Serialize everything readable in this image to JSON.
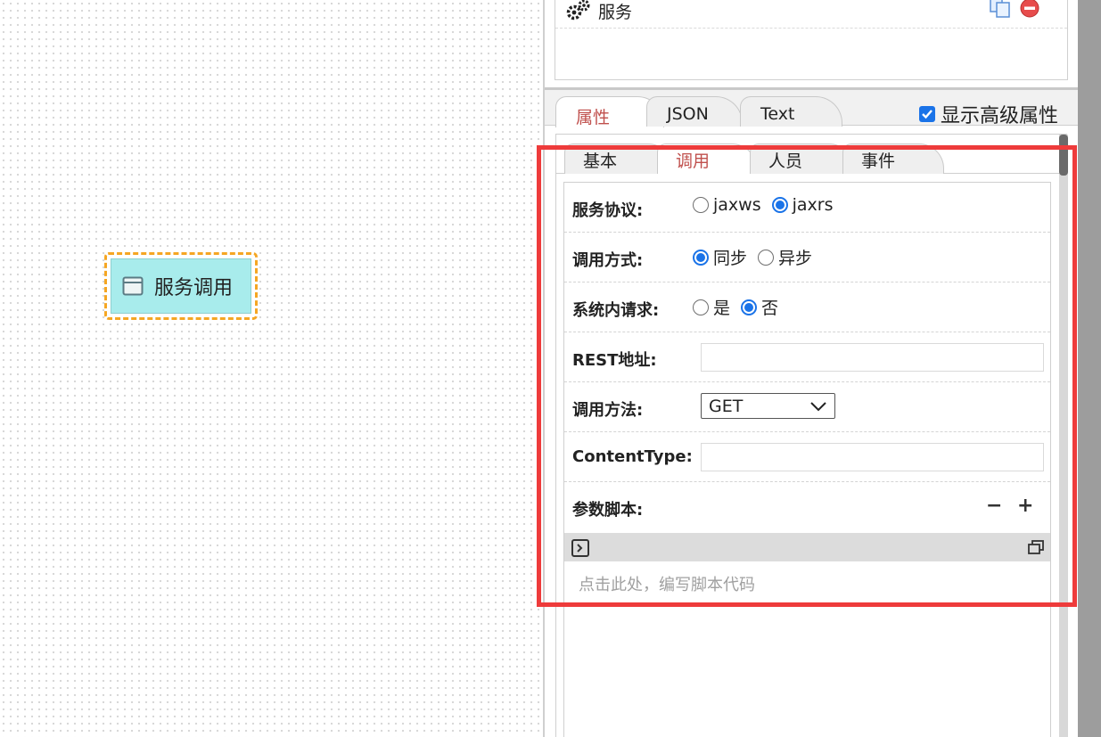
{
  "canvas": {
    "node_label": "服务调用"
  },
  "service_list": {
    "items": [
      {
        "label": "服务"
      }
    ]
  },
  "tabs": [
    {
      "label": "属性"
    },
    {
      "label": "JSON"
    },
    {
      "label": "Text"
    }
  ],
  "advanced": {
    "label": "显示高级属性",
    "checked": true
  },
  "subtabs": [
    {
      "label": "基本"
    },
    {
      "label": "调用"
    },
    {
      "label": "人员"
    },
    {
      "label": "事件"
    }
  ],
  "form": {
    "protocol": {
      "label": "服务协议:",
      "options": [
        "jaxws",
        "jaxrs"
      ],
      "selected": "jaxrs"
    },
    "call_mode": {
      "label": "调用方式:",
      "options": [
        "同步",
        "异步"
      ],
      "selected": "同步"
    },
    "internal": {
      "label": "系统内请求:",
      "options": [
        "是",
        "否"
      ],
      "selected": "否"
    },
    "rest_address": {
      "label": "REST地址:",
      "value": ""
    },
    "method": {
      "label": "调用方法:",
      "value": "GET"
    },
    "content_type": {
      "label": "ContentType:",
      "value": ""
    },
    "param_script": {
      "label": "参数脚本:",
      "minus": "−",
      "plus": "+",
      "placeholder": "点击此处，编写脚本代码"
    }
  },
  "colors": {
    "accent_tab": "#c0504d",
    "radio": "#1a73e8",
    "highlight": "#ee3b3b",
    "node_fill": "#a8ecec",
    "node_border": "#f5a623"
  }
}
